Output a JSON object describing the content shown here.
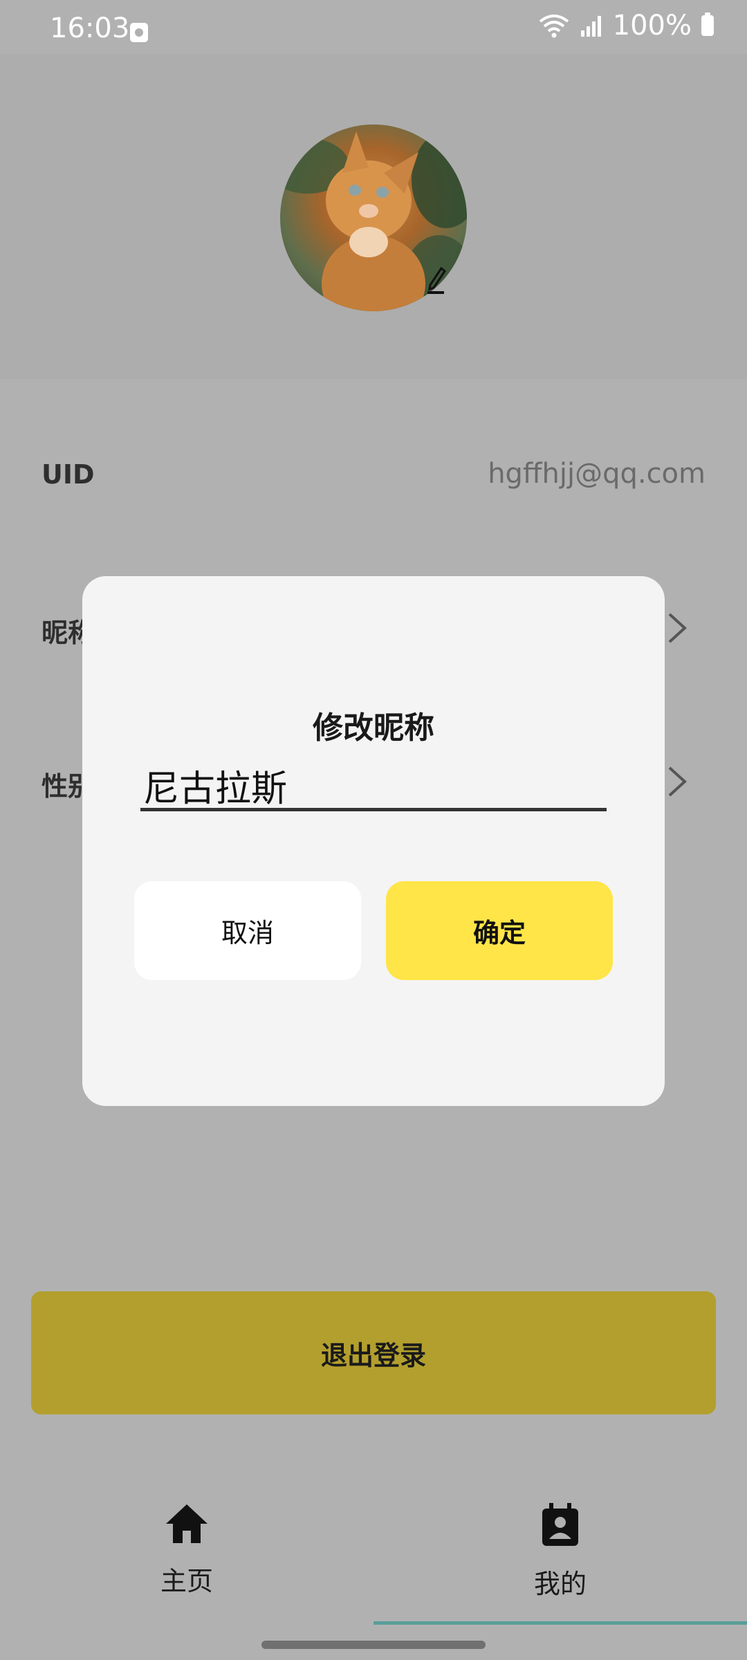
{
  "status_bar": {
    "time": "16:03",
    "battery": "100%"
  },
  "profile": {
    "uid_label": "UID",
    "uid_value": "hgffhjj@qq.com",
    "nickname_label": "昵称",
    "gender_label": "性别"
  },
  "dialog": {
    "title": "修改昵称",
    "input_value": "尼古拉斯",
    "cancel_label": "取消",
    "confirm_label": "确定"
  },
  "logout_label": "退出登录",
  "bottom_nav": {
    "items": [
      {
        "label": "主页",
        "icon": "home-icon"
      },
      {
        "label": "我的",
        "icon": "contact-card-icon"
      }
    ]
  },
  "colors": {
    "scrim": "#b1b1b1",
    "accent_yellow": "#ffe548",
    "logout_dimmed": "#b39f2e",
    "nav_indicator": "#5a9e99"
  }
}
